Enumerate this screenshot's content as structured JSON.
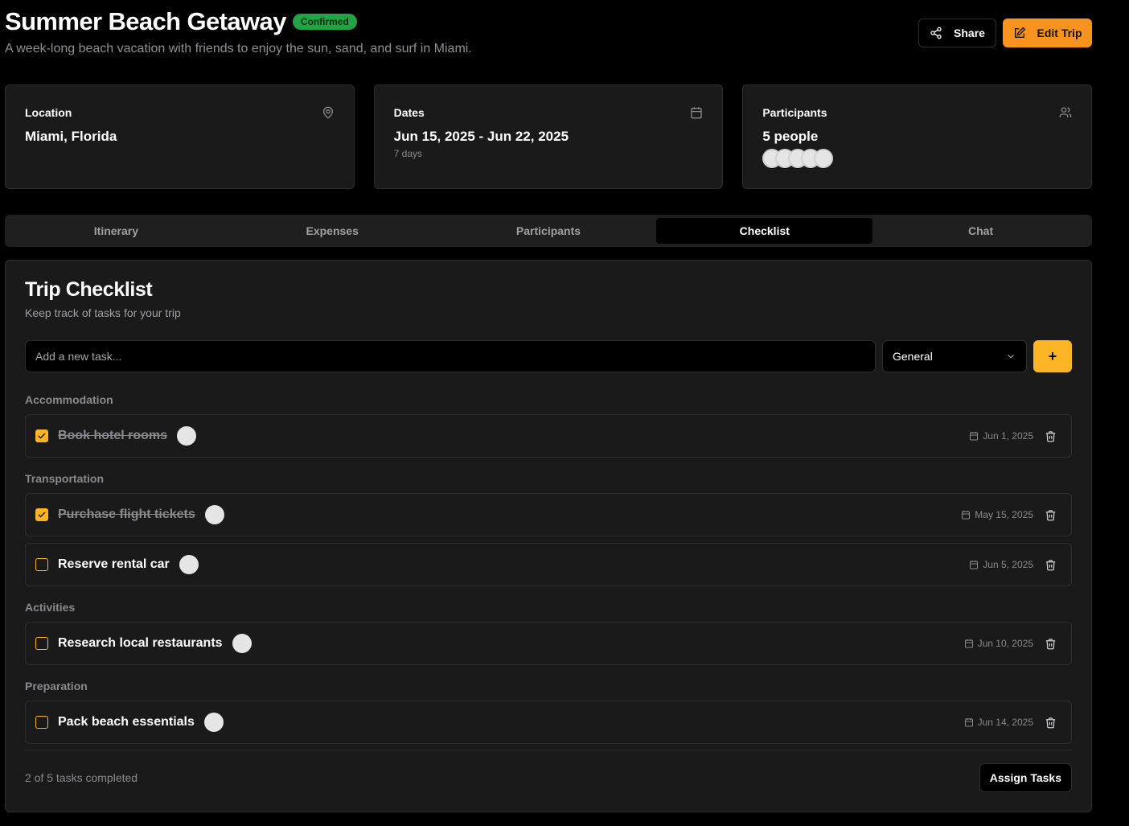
{
  "trip": {
    "title": "Summer Beach Getaway",
    "status": "Confirmed",
    "description": "A week-long beach vacation with friends to enjoy the sun, sand, and surf in Miami."
  },
  "actions": {
    "share_label": "Share",
    "edit_label": "Edit Trip"
  },
  "cards": {
    "location": {
      "label": "Location",
      "value": "Miami, Florida",
      "icon": "map-pin-icon"
    },
    "dates": {
      "label": "Dates",
      "value": "Jun 15, 2025 - Jun 22, 2025",
      "sub": "7 days",
      "icon": "calendar-icon"
    },
    "participants": {
      "label": "Participants",
      "value": "5 people",
      "icon": "users-icon",
      "avatar_count": 5
    }
  },
  "tabs": [
    {
      "label": "Itinerary"
    },
    {
      "label": "Expenses"
    },
    {
      "label": "Participants"
    },
    {
      "label": "Checklist",
      "active": true
    },
    {
      "label": "Chat"
    }
  ],
  "checklist": {
    "title": "Trip Checklist",
    "description": "Keep track of tasks for your trip",
    "input_placeholder": "Add a new task...",
    "category_selected": "General",
    "add_label": "+",
    "groups": [
      {
        "name": "Accommodation",
        "tasks": [
          {
            "name": "Book hotel rooms",
            "done": true,
            "date": "Jun 1, 2025"
          }
        ]
      },
      {
        "name": "Transportation",
        "tasks": [
          {
            "name": "Purchase flight tickets",
            "done": true,
            "date": "May 15, 2025"
          },
          {
            "name": "Reserve rental car",
            "done": false,
            "date": "Jun 5, 2025"
          }
        ]
      },
      {
        "name": "Activities",
        "tasks": [
          {
            "name": "Research local restaurants",
            "done": false,
            "date": "Jun 10, 2025"
          }
        ]
      },
      {
        "name": "Preparation",
        "tasks": [
          {
            "name": "Pack beach essentials",
            "done": false,
            "date": "Jun 14, 2025"
          }
        ]
      }
    ],
    "summary": "2 of 5 tasks completed",
    "assign_label": "Assign Tasks"
  },
  "colors": {
    "accent": "#fbb424",
    "edit_button": "#f7931e",
    "badge": "#22a446"
  }
}
